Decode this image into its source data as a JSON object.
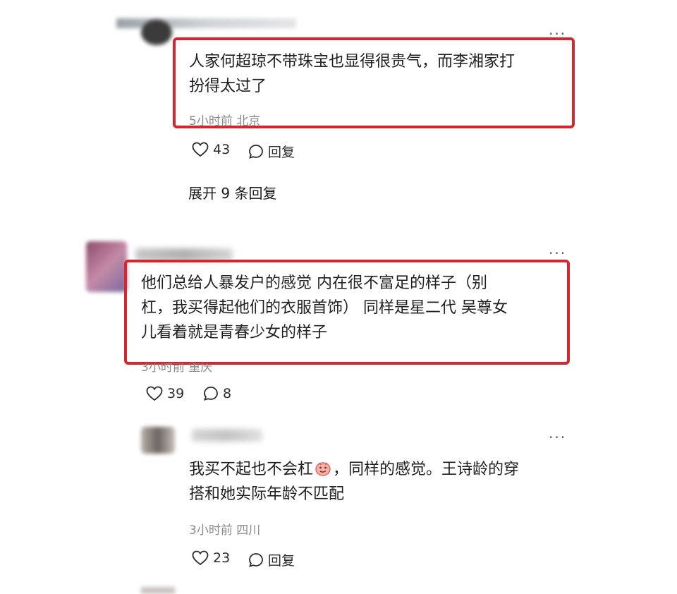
{
  "comments": [
    {
      "text_line1": "人家何超琼不带珠宝也显得很贵气，而李湘家打",
      "text_line2": "扮得太过了",
      "meta": "5小时前 北京",
      "likes": "43",
      "reply_label": "回复"
    },
    {
      "text_line1": "他们总给人暴发户的感觉 内在很不富足的样子（别",
      "text_line2": "杠，我买得起他们的衣服首饰） 同样是星二代 吴尊女",
      "text_line3": "儿看着就是青春少女的样子",
      "meta": "3小时前 重庆",
      "likes": "39",
      "replies": "8"
    }
  ],
  "expand_replies": "展开 9 条回复",
  "reply": {
    "text_line1_a": "我买不起也不会杠",
    "text_line1_b": "，同样的感觉。王诗龄的穿",
    "text_line2": "搭和她实际年龄不匹配",
    "meta": "3小时前 四川",
    "likes": "23",
    "reply_label": "回复"
  },
  "more_label": "···",
  "colors": {
    "highlight": "#d3272f",
    "meta": "#8a8a8a"
  },
  "icons": [
    "heart-icon",
    "comment-bubble-icon",
    "more-dots-icon",
    "smirk-emoji-icon"
  ]
}
